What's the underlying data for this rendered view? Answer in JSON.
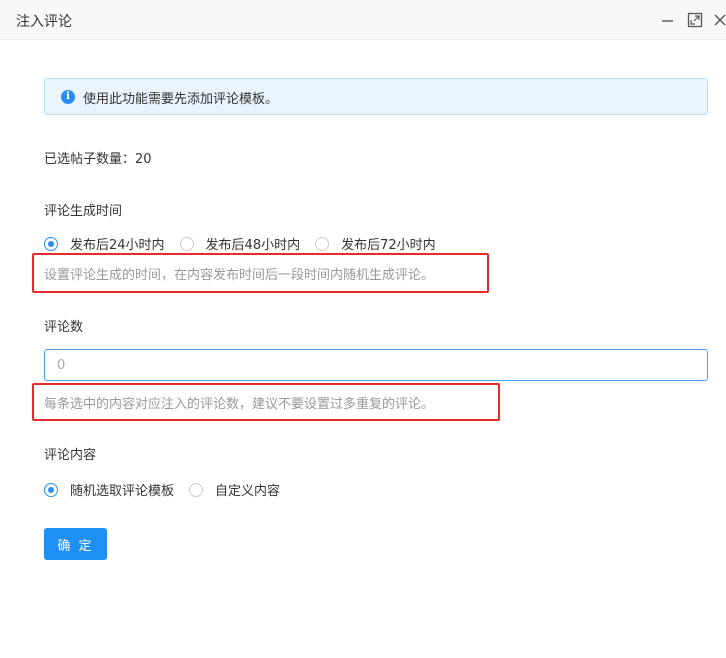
{
  "dialog": {
    "title": "注入评论",
    "icons": {
      "minimize": "minimize-icon",
      "maximize": "maximize-icon",
      "close": "close-icon"
    }
  },
  "alert": {
    "icon": "info-icon",
    "text": "使用此功能需要先添加评论模板。",
    "accent": "#2d8cf0"
  },
  "selected_count": {
    "label": "已选帖子数量：",
    "value": "20"
  },
  "comment_time": {
    "label": "评论生成时间",
    "options": [
      {
        "label": "发布后24小时内",
        "checked": true
      },
      {
        "label": "发布后48小时内",
        "checked": false
      },
      {
        "label": "发布后72小时内",
        "checked": false
      }
    ],
    "hint": "设置评论生成的时间，在内容发布时间后一段时间内随机生成评论。"
  },
  "comment_count": {
    "label": "评论数",
    "placeholder": "0",
    "value": "",
    "hint": "每条选中的内容对应注入的评论数，建议不要设置过多重复的评论。"
  },
  "comment_content": {
    "label": "评论内容",
    "options": [
      {
        "label": "随机选取评论模板",
        "checked": true
      },
      {
        "label": "自定义内容",
        "checked": false
      }
    ]
  },
  "actions": {
    "confirm_label": "确 定"
  },
  "colors": {
    "primary": "#1e90f5",
    "highlight_border": "#e52b2b",
    "hint_text": "#999999"
  }
}
